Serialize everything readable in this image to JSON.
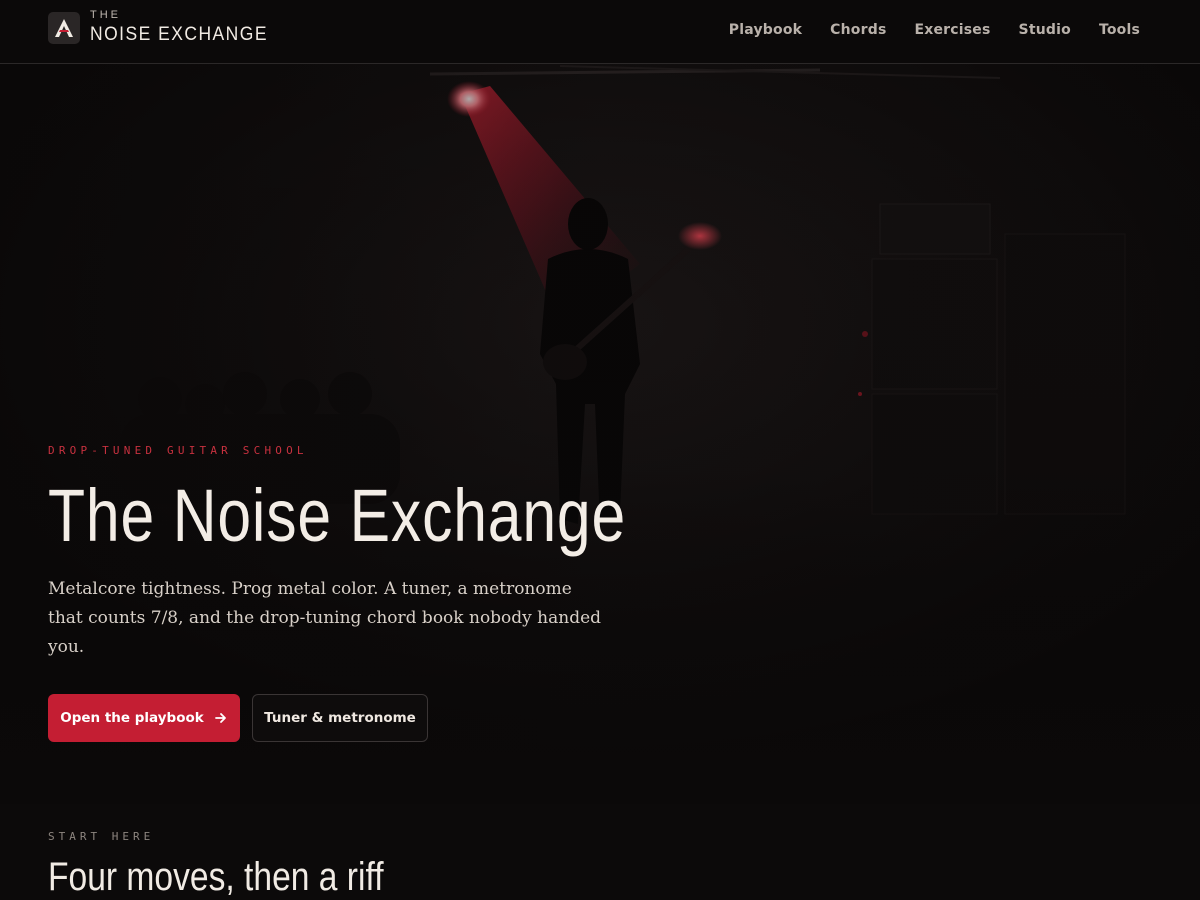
{
  "header": {
    "brand_small": "THE",
    "brand_big": "NOISE EXCHANGE",
    "nav": [
      "Playbook",
      "Chords",
      "Exercises",
      "Studio",
      "Tools"
    ]
  },
  "hero": {
    "eyebrow": "DROP-TUNED GUITAR SCHOOL",
    "title": "The Noise Exchange",
    "subtitle": "Metalcore tightness. Prog metal color. A tuner, a metronome that counts 7/8, and the drop-tuning chord book nobody handed you.",
    "primary_cta": "Open the playbook",
    "secondary_cta": "Tuner & metronome"
  },
  "section": {
    "eyebrow": "START HERE",
    "title": "Four moves, then a riff"
  },
  "colors": {
    "accent": "#c41e33",
    "background": "#0c0a0a",
    "text": "#f3ede6"
  },
  "icons": {
    "logo": "triangle-a-logo-icon",
    "cta_arrow": "arrow-right-icon"
  }
}
